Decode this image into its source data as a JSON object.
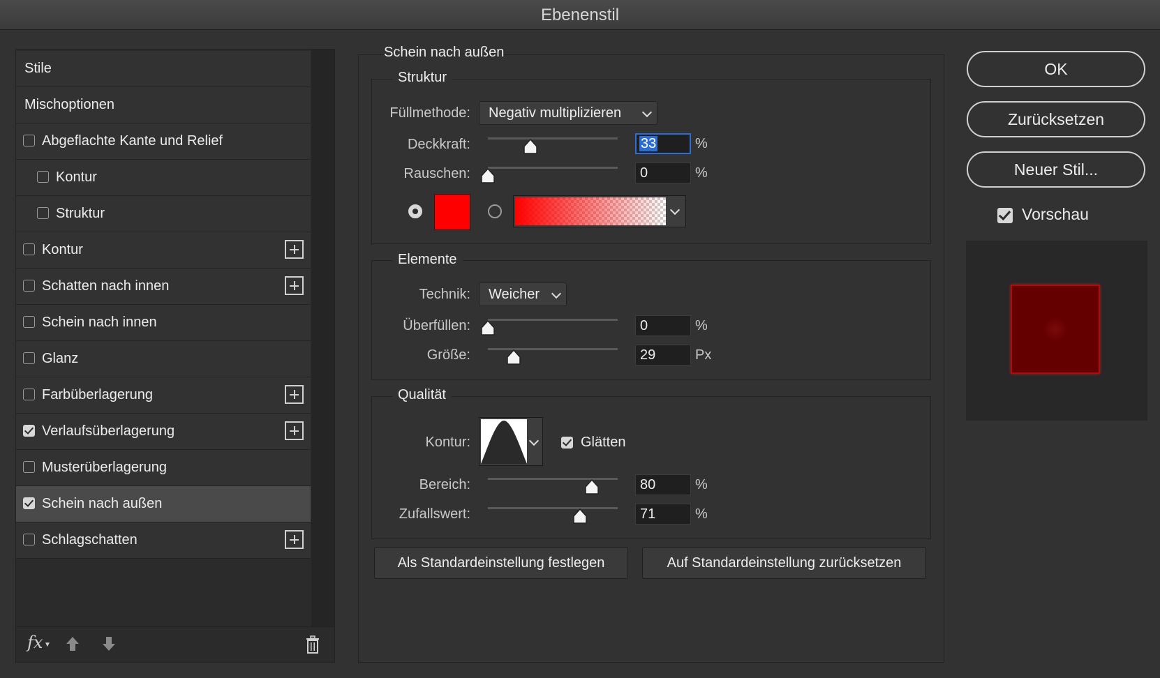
{
  "window": {
    "title": "Ebenenstil"
  },
  "styles_panel": {
    "header": "Stile",
    "blending": "Mischoptionen",
    "items": [
      {
        "label": "Abgeflachte Kante und Relief",
        "checked": false,
        "indent": false,
        "plus": false
      },
      {
        "label": "Kontur",
        "checked": false,
        "indent": true,
        "plus": false
      },
      {
        "label": "Struktur",
        "checked": false,
        "indent": true,
        "plus": false
      },
      {
        "label": "Kontur",
        "checked": false,
        "indent": false,
        "plus": true
      },
      {
        "label": "Schatten nach innen",
        "checked": false,
        "indent": false,
        "plus": true
      },
      {
        "label": "Schein nach innen",
        "checked": false,
        "indent": false,
        "plus": false
      },
      {
        "label": "Glanz",
        "checked": false,
        "indent": false,
        "plus": false
      },
      {
        "label": "Farbüberlagerung",
        "checked": false,
        "indent": false,
        "plus": true
      },
      {
        "label": "Verlaufsüberlagerung",
        "checked": true,
        "indent": false,
        "plus": true
      },
      {
        "label": "Musterüberlagerung",
        "checked": false,
        "indent": false,
        "plus": false
      },
      {
        "label": "Schein nach außen",
        "checked": true,
        "indent": false,
        "plus": false,
        "selected": true
      },
      {
        "label": "Schlagschatten",
        "checked": false,
        "indent": false,
        "plus": true
      }
    ],
    "footer": {
      "fx": "fx",
      "icons": [
        "fx-menu-icon",
        "move-up-icon",
        "move-down-icon",
        "trash-icon"
      ]
    }
  },
  "outer_glow": {
    "title": "Schein nach außen",
    "structure": {
      "title": "Struktur",
      "blend_label": "Füllmethode:",
      "blend_value": "Negativ multiplizieren",
      "opacity_label": "Deckkraft:",
      "opacity_value": "33",
      "opacity_fraction": 0.33,
      "opacity_unit": "%",
      "noise_label": "Rauschen:",
      "noise_value": "0",
      "noise_fraction": 0.0,
      "noise_unit": "%",
      "color_mode": "solid",
      "color": "#ff0000"
    },
    "elements": {
      "title": "Elemente",
      "technique_label": "Technik:",
      "technique_value": "Weicher",
      "spread_label": "Überfüllen:",
      "spread_value": "0",
      "spread_fraction": 0.0,
      "spread_unit": "%",
      "size_label": "Größe:",
      "size_value": "29",
      "size_fraction": 0.2,
      "size_unit": "Px"
    },
    "quality": {
      "title": "Qualität",
      "contour_label": "Kontur:",
      "antialias_label": "Glätten",
      "antialias_checked": true,
      "range_label": "Bereich:",
      "range_value": "80",
      "range_fraction": 0.8,
      "range_unit": "%",
      "jitter_label": "Zufallswert:",
      "jitter_value": "71",
      "jitter_fraction": 0.71,
      "jitter_unit": "%"
    },
    "buttons": {
      "make_default": "Als Standardeinstellung festlegen",
      "reset_default": "Auf Standardeinstellung zurücksetzen"
    }
  },
  "actions": {
    "ok": "OK",
    "reset": "Zurücksetzen",
    "new_style": "Neuer Stil...",
    "preview_label": "Vorschau",
    "preview_checked": true
  },
  "colors": {
    "accent": "#2d6dd6",
    "glow": "#ff0000",
    "preview_fill": "#650000"
  }
}
